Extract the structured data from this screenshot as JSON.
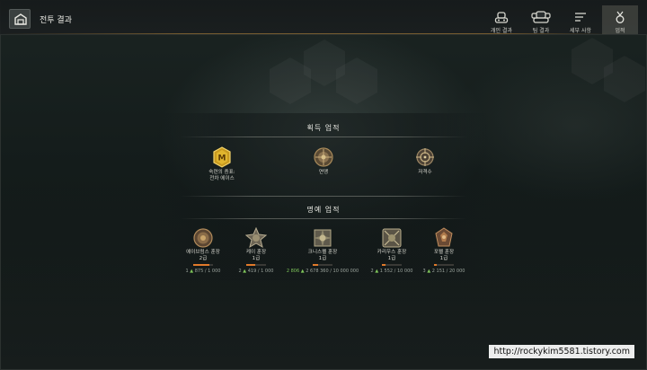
{
  "header": {
    "title": "전투 결과",
    "tabs": [
      {
        "label": "개인 결과",
        "icon": "tank-icon",
        "active": false
      },
      {
        "label": "팀 결과",
        "icon": "team-tanks-icon",
        "active": false
      },
      {
        "label": "세부 사항",
        "icon": "details-list-icon",
        "active": false
      },
      {
        "label": "업적",
        "icon": "medal-icon",
        "active": true
      }
    ]
  },
  "achievements": {
    "title": "획득 업적",
    "items": [
      {
        "label_line1": "숙련의 증표:",
        "label_line2": "전차 에이스",
        "icon": "mastery-ace-medal-icon"
      },
      {
        "label_line1": "연맹",
        "label_line2": "",
        "icon": "brotherhood-medal-icon"
      },
      {
        "label_line1": "저격수",
        "label_line2": "",
        "icon": "sniper-medal-icon"
      }
    ]
  },
  "honors": {
    "title": "명예 업적",
    "items": [
      {
        "name": "에이브럼스 훈장",
        "grade": "2급",
        "step": "1",
        "current": "875",
        "target": "1 000",
        "progress": 0.8,
        "icon": "abrams-medal-icon"
      },
      {
        "name": "케이 훈장",
        "grade": "1급",
        "step": "2",
        "current": "419",
        "target": "1 000",
        "progress": 0.45,
        "icon": "kay-medal-icon"
      },
      {
        "name": "크니스펠 훈장",
        "grade": "1급",
        "step": "2 806",
        "current": "2 678 360",
        "target": "10 000 000",
        "progress": 0.28,
        "icon": "knispel-medal-icon"
      },
      {
        "name": "카리우스 훈장",
        "grade": "1급",
        "step": "2",
        "current": "1 552",
        "target": "10 000",
        "progress": 0.18,
        "icon": "carius-medal-icon"
      },
      {
        "name": "포펠 훈장",
        "grade": "1급",
        "step": "3",
        "current": "2 151",
        "target": "20 000",
        "progress": 0.12,
        "icon": "popel-medal-icon"
      }
    ]
  },
  "watermark": "http://rockykim5581.tistory.com",
  "colors": {
    "progress_fill": "#e07a2a",
    "progress_arrow": "#7ec45a",
    "tab_active_bg": "#5a5a52"
  }
}
